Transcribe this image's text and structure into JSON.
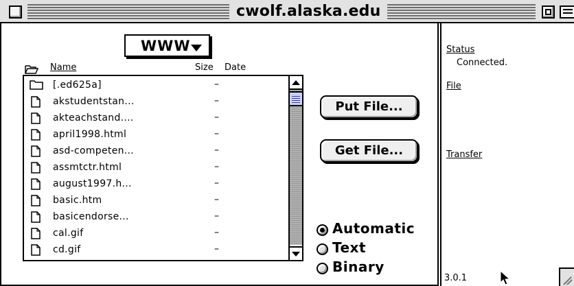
{
  "window": {
    "title": "cwolf.alaska.edu"
  },
  "directory_popup": {
    "label": "WWW"
  },
  "list_header": {
    "name": "Name",
    "size": "Size",
    "date": "Date"
  },
  "files": [
    {
      "name": "[.ed625a]",
      "size": "–",
      "kind": "folder"
    },
    {
      "name": "akstudentstan...",
      "size": "–",
      "kind": "document"
    },
    {
      "name": "akteachstand....",
      "size": "–",
      "kind": "document"
    },
    {
      "name": "april1998.html",
      "size": "–",
      "kind": "document"
    },
    {
      "name": "asd-competen...",
      "size": "–",
      "kind": "document"
    },
    {
      "name": "assmtctr.html",
      "size": "–",
      "kind": "document"
    },
    {
      "name": "august1997.h...",
      "size": "–",
      "kind": "document"
    },
    {
      "name": "basic.htm",
      "size": "–",
      "kind": "document"
    },
    {
      "name": "basicendorse...",
      "size": "–",
      "kind": "document"
    },
    {
      "name": "cal.gif",
      "size": "–",
      "kind": "document"
    },
    {
      "name": "cd.gif",
      "size": "–",
      "kind": "document"
    }
  ],
  "buttons": {
    "put_file": "Put File...",
    "get_file": "Get File..."
  },
  "transfer_mode": {
    "options": [
      "Automatic",
      "Text",
      "Binary"
    ],
    "selected": "Automatic"
  },
  "status_panel": {
    "status_label": "Status",
    "status_value": "Connected.",
    "file_label": "File",
    "transfer_label": "Transfer",
    "version": "3.0.1"
  },
  "colors": {
    "window_chrome": "#e2e2e2",
    "scroll_thumb": "#c9d2f4",
    "scroll_track": "#b8b8b8"
  }
}
